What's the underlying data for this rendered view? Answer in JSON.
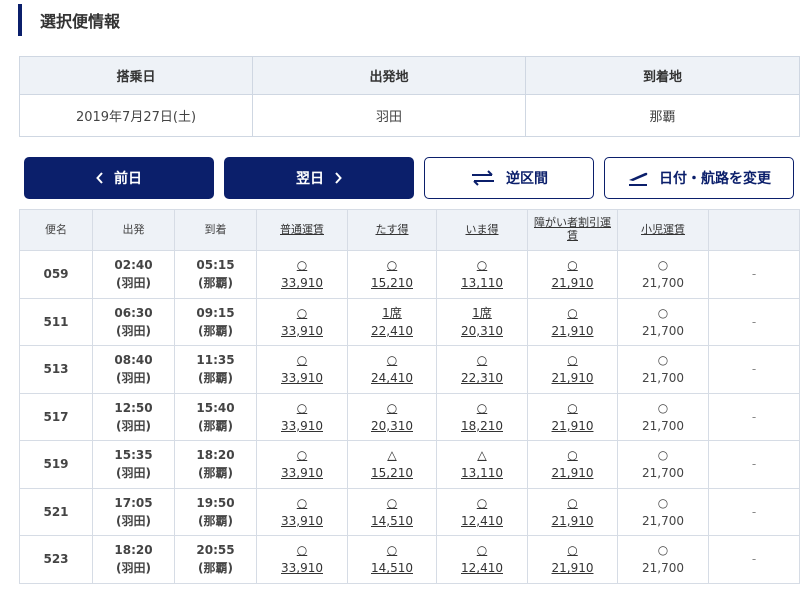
{
  "page": {
    "title": "選択便情報"
  },
  "info": {
    "headers": [
      "搭乗日",
      "出発地",
      "到着地"
    ],
    "values": [
      "2019年7月27日(土)",
      "羽田",
      "那覇"
    ]
  },
  "nav": {
    "prev": "前日",
    "next": "翌日",
    "reverse": "逆区間",
    "change": "日付・航路を変更"
  },
  "flights": {
    "headers": {
      "flight": "便名",
      "dep": "出発",
      "arr": "到着",
      "normal": "普通運賃",
      "tasu": "たす得",
      "ima": "いま得",
      "disabled": "障がい者割引運賃",
      "child": "小児運賃"
    },
    "rows": [
      {
        "no": "059",
        "dep": "02:40",
        "dep_ap": "(羽田)",
        "arr": "05:15",
        "arr_ap": "(那覇)",
        "normal": [
          "○",
          "33,910"
        ],
        "tasu": [
          "○",
          "15,210"
        ],
        "ima": [
          "○",
          "13,110"
        ],
        "disabled": [
          "○",
          "21,910"
        ],
        "child": [
          "○",
          "21,700"
        ],
        "extra": "-"
      },
      {
        "no": "511",
        "dep": "06:30",
        "dep_ap": "(羽田)",
        "arr": "09:15",
        "arr_ap": "(那覇)",
        "normal": [
          "○",
          "33,910"
        ],
        "tasu": [
          "1席",
          "22,410"
        ],
        "ima": [
          "1席",
          "20,310"
        ],
        "disabled": [
          "○",
          "21,910"
        ],
        "child": [
          "○",
          "21,700"
        ],
        "extra": "-"
      },
      {
        "no": "513",
        "dep": "08:40",
        "dep_ap": "(羽田)",
        "arr": "11:35",
        "arr_ap": "(那覇)",
        "normal": [
          "○",
          "33,910"
        ],
        "tasu": [
          "○",
          "24,410"
        ],
        "ima": [
          "○",
          "22,310"
        ],
        "disabled": [
          "○",
          "21,910"
        ],
        "child": [
          "○",
          "21,700"
        ],
        "extra": "-"
      },
      {
        "no": "517",
        "dep": "12:50",
        "dep_ap": "(羽田)",
        "arr": "15:40",
        "arr_ap": "(那覇)",
        "normal": [
          "○",
          "33,910"
        ],
        "tasu": [
          "○",
          "20,310"
        ],
        "ima": [
          "○",
          "18,210"
        ],
        "disabled": [
          "○",
          "21,910"
        ],
        "child": [
          "○",
          "21,700"
        ],
        "extra": "-"
      },
      {
        "no": "519",
        "dep": "15:35",
        "dep_ap": "(羽田)",
        "arr": "18:20",
        "arr_ap": "(那覇)",
        "normal": [
          "○",
          "33,910"
        ],
        "tasu": [
          "△",
          "15,210"
        ],
        "ima": [
          "△",
          "13,110"
        ],
        "disabled": [
          "○",
          "21,910"
        ],
        "child": [
          "○",
          "21,700"
        ],
        "extra": "-"
      },
      {
        "no": "521",
        "dep": "17:05",
        "dep_ap": "(羽田)",
        "arr": "19:50",
        "arr_ap": "(那覇)",
        "normal": [
          "○",
          "33,910"
        ],
        "tasu": [
          "○",
          "14,510"
        ],
        "ima": [
          "○",
          "12,410"
        ],
        "disabled": [
          "○",
          "21,910"
        ],
        "child": [
          "○",
          "21,700"
        ],
        "extra": "-"
      },
      {
        "no": "523",
        "dep": "18:20",
        "dep_ap": "(羽田)",
        "arr": "20:55",
        "arr_ap": "(那覇)",
        "normal": [
          "○",
          "33,910"
        ],
        "tasu": [
          "○",
          "14,510"
        ],
        "ima": [
          "○",
          "12,410"
        ],
        "disabled": [
          "○",
          "21,910"
        ],
        "child": [
          "○",
          "21,700"
        ],
        "extra": "-"
      }
    ]
  }
}
